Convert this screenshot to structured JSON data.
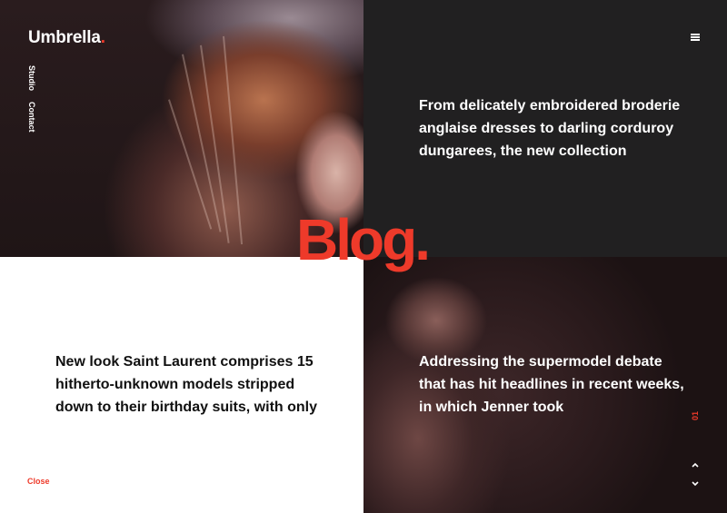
{
  "brand": {
    "name": "Umbrella",
    "dot": "."
  },
  "nav": {
    "studio": "Studio",
    "contact": "Contact"
  },
  "headline": "Blog.",
  "posts": [
    {
      "text": "From delicately embroidered broderie anglaise dresses to darling corduroy dungarees, the new collection"
    },
    {
      "text": "New look Saint Laurent comprises 15 hitherto-unknown models stripped down to their birthday suits, with only"
    },
    {
      "text": "Addressing the supermodel debate that has hit headlines in recent weeks, in which Jenner took"
    }
  ],
  "close_label": "Close",
  "page_indicator": "01",
  "icons": {
    "menu": "hamburger-menu-icon",
    "up": "chevron-up-icon",
    "down": "chevron-down-icon"
  },
  "colors": {
    "accent": "#ee3a2a",
    "dark_panel": "#212021",
    "white_panel": "#ffffff"
  }
}
